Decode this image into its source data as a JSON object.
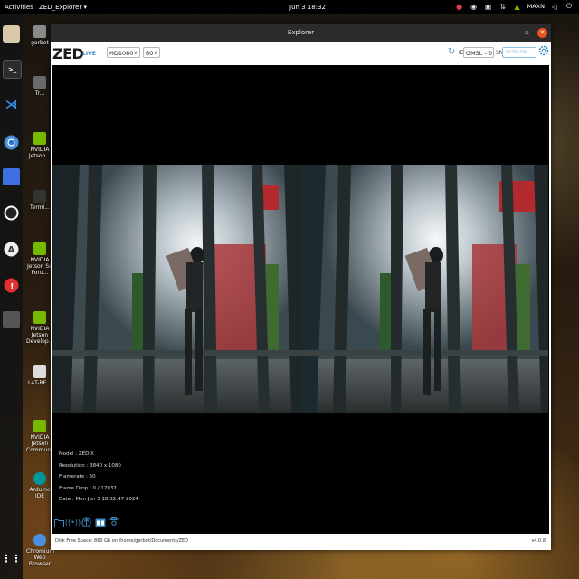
{
  "topbar": {
    "activities": "Activities",
    "app_menu": "ZED_Explorer ▾",
    "clock": "Jun 3  18:32",
    "tray_label": "MAXN"
  },
  "dock": {
    "items": [
      "files-icon",
      "terminal-icon",
      "vscode-icon",
      "chromium-icon",
      "screenshot-icon",
      "obs-icon",
      "text-editor-icon",
      "software-icon",
      "window-icon",
      "apps-grid-icon"
    ]
  },
  "desktop": {
    "icons": [
      {
        "label": "gerbot"
      },
      {
        "label": "Tr..."
      },
      {
        "label": "NVIDIA Jetson..."
      },
      {
        "label": "Termi..."
      },
      {
        "label": "NVIDIA Jetson Su Foru..."
      },
      {
        "label": "NVIDIA Jetson Develop..."
      },
      {
        "label": "L4T-RE..."
      },
      {
        "label": "NVIDIA Jetson Commun..."
      },
      {
        "label": "Arduino IDE"
      },
      {
        "label": "Chromium Web Browser"
      }
    ]
  },
  "window": {
    "title": "Explorer",
    "logo": "ZED",
    "live": "LIVE",
    "resolution_select": "HD1080",
    "fps_select": "60",
    "id_label": "ID",
    "id_select": "GMSL - 0",
    "sn_label": "SN",
    "sn_value": "42706498"
  },
  "overlay": {
    "model": "Model : ZED-X",
    "resolution": "Resolution : 3840 x 1080",
    "framerate": "Framerate : 60",
    "frame_drop": "Frame Drop : 0 / 17037",
    "date": "Date : Mon Jun 3 18:32:47 2024"
  },
  "status": {
    "disk": "Disk Free Space: 860 Gb  on  /home/gerbot/Documents/ZED",
    "version": "v4.0.8"
  },
  "colors": {
    "accent": "#3b8ac4",
    "close_button": "#e95420"
  }
}
